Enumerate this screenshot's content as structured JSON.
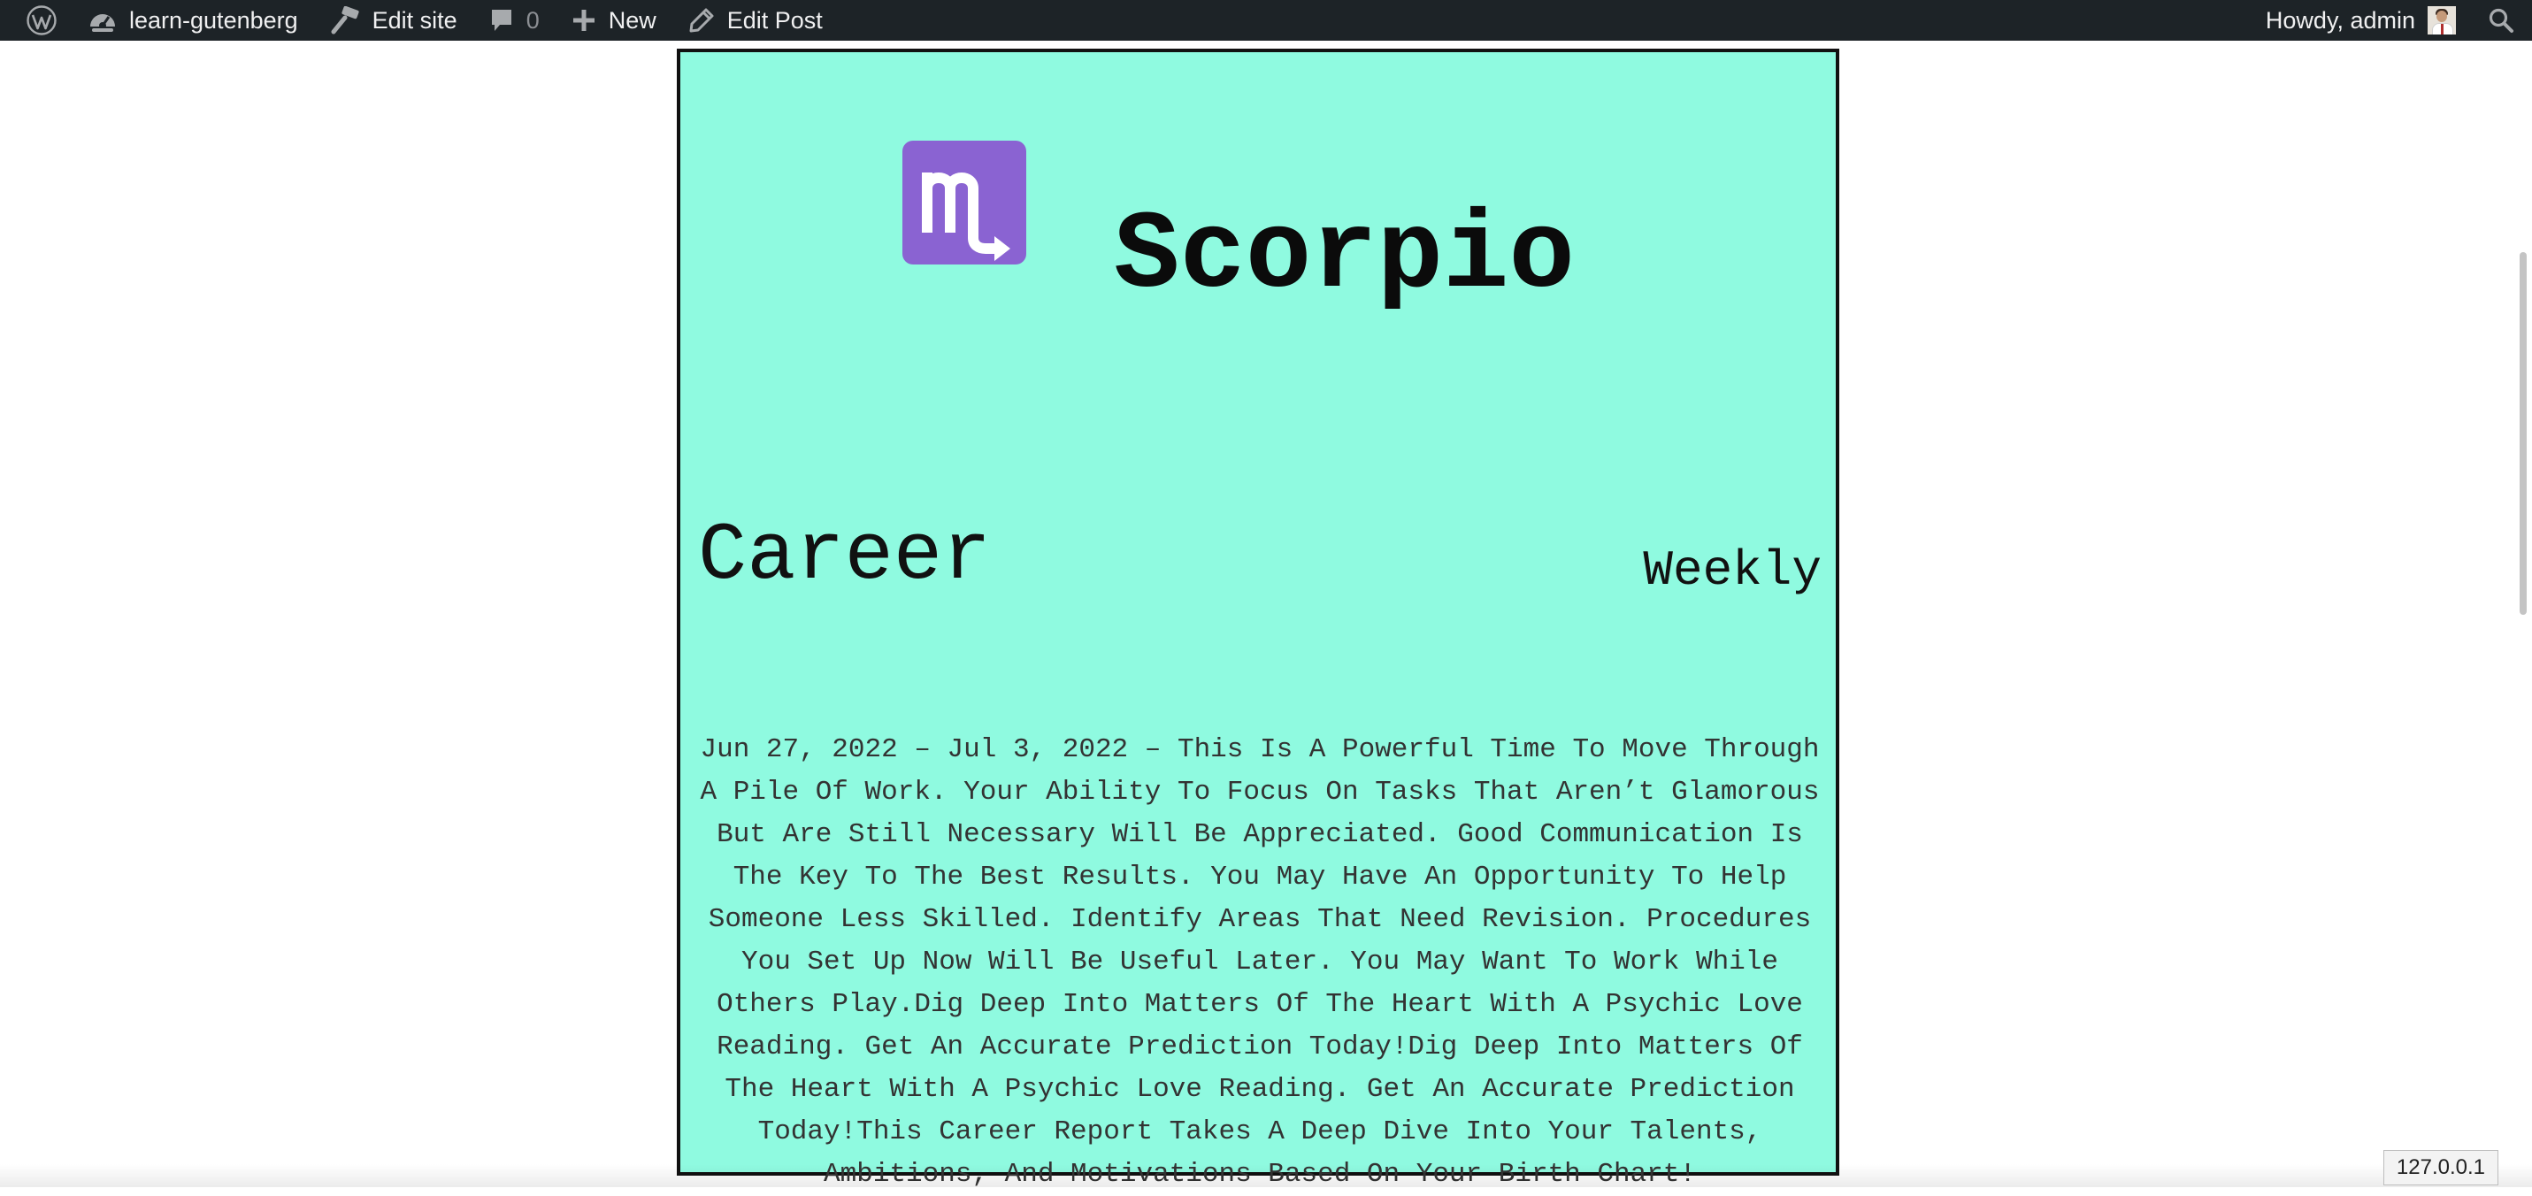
{
  "admin_bar": {
    "site_name": "learn-gutenberg",
    "edit_site": "Edit site",
    "comments_count": "0",
    "new_label": "New",
    "edit_post": "Edit Post",
    "greeting": "Howdy, admin",
    "icons": [
      "wordpress-logo-icon",
      "dashboard-icon",
      "brush-icon",
      "comment-bubble-icon",
      "plus-icon",
      "pencil-icon",
      "search-icon"
    ]
  },
  "horoscope": {
    "sign": "Scorpio",
    "sign_symbol": "♏",
    "category": "Career",
    "period": "Weekly",
    "reading": "Jun 27, 2022 – Jul 3, 2022 – This Is A Powerful Time To Move Through A Pile Of Work. Your Ability To Focus On Tasks That Aren’t Glamorous But Are Still Necessary Will Be Appreciated. Good Communication Is The Key To The Best Results. You May Have An Opportunity To Help Someone Less Skilled. Identify Areas That Need Revision. Procedures You Set Up Now Will Be Useful Later. You May Want To Work While Others Play.Dig Deep Into Matters Of The Heart With A Psychic Love Reading. Get An Accurate Prediction Today!Dig Deep Into Matters Of The Heart With A Psychic Love Reading. Get An Accurate Prediction Today!This Career Report Takes A Deep Dive Into Your Talents, Ambitions, And Motivations Based On Your Birth Chart!"
  },
  "status_bar": {
    "host": "127.0.0.1"
  },
  "colors": {
    "card_background": "#8ffae0",
    "sign_badge": "#8a63d2",
    "admin_bar": "#1d2327"
  }
}
